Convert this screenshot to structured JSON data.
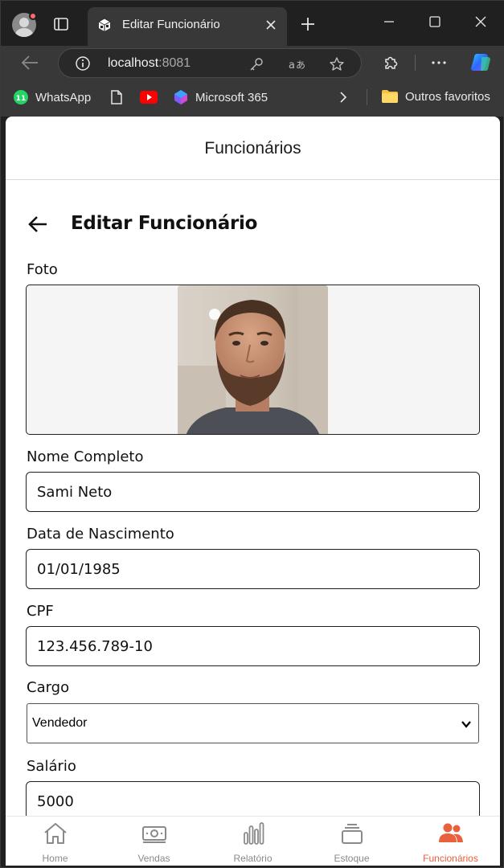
{
  "browser": {
    "tab_title": "Editar Funcionário",
    "url_host": "localhost",
    "url_port": ":8081",
    "bookmarks": [
      "WhatsApp",
      "Microsoft 365",
      "Outros favoritos"
    ],
    "whatsapp_badge": "11"
  },
  "app": {
    "header_title": "Funcionários",
    "form_title": "Editar Funcionário"
  },
  "form": {
    "photo_label": "Foto",
    "name_label": "Nome Completo",
    "name_value": "Sami Neto",
    "birth_label": "Data de Nascimento",
    "birth_value": "01/01/1985",
    "cpf_label": "CPF",
    "cpf_value": "123.456.789-10",
    "role_label": "Cargo",
    "role_value": "Vendedor",
    "salary_label": "Salário",
    "salary_value": "5000"
  },
  "nav": {
    "items": [
      {
        "label": "Home",
        "icon": "home-icon"
      },
      {
        "label": "Vendas",
        "icon": "money-icon"
      },
      {
        "label": "Relatório",
        "icon": "bar-chart-icon"
      },
      {
        "label": "Estoque",
        "icon": "stack-icon"
      },
      {
        "label": "Funcionários",
        "icon": "people-icon"
      }
    ],
    "active_index": 4,
    "active_color": "#e8603c"
  }
}
